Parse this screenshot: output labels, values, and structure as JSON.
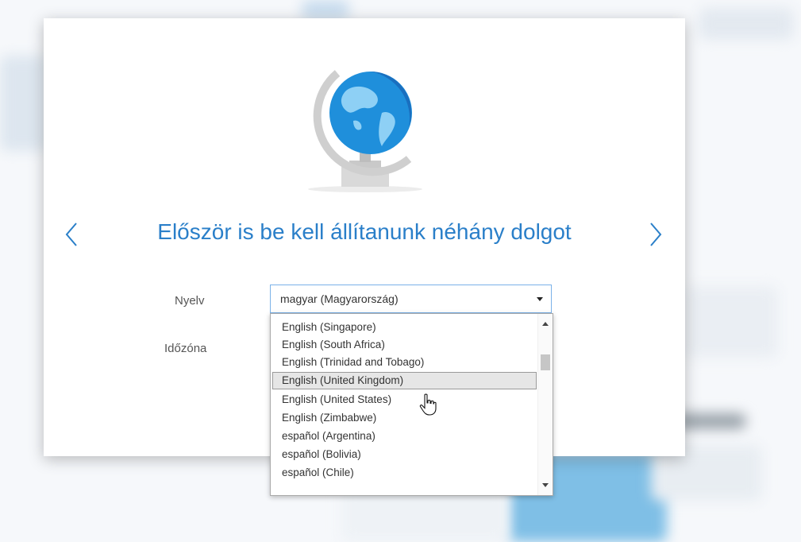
{
  "dialog": {
    "title": "Először is be kell állítanunk néhány dolgot",
    "nav_prev_icon": "chevron-left-icon",
    "nav_next_icon": "chevron-right-icon",
    "accent_color": "#2a7fc9"
  },
  "form": {
    "language_label": "Nyelv",
    "timezone_label": "Időzóna",
    "language_selected": "magyar (Magyarország)"
  },
  "dropdown": {
    "options": [
      "English (Singapore)",
      "English (South Africa)",
      "English (Trinidad and Tobago)",
      "English (United Kingdom)",
      "English (United States)",
      "English (Zimbabwe)",
      "español (Argentina)",
      "español (Bolivia)",
      "español (Chile)"
    ],
    "hovered_option": "English (United Kingdom)"
  }
}
